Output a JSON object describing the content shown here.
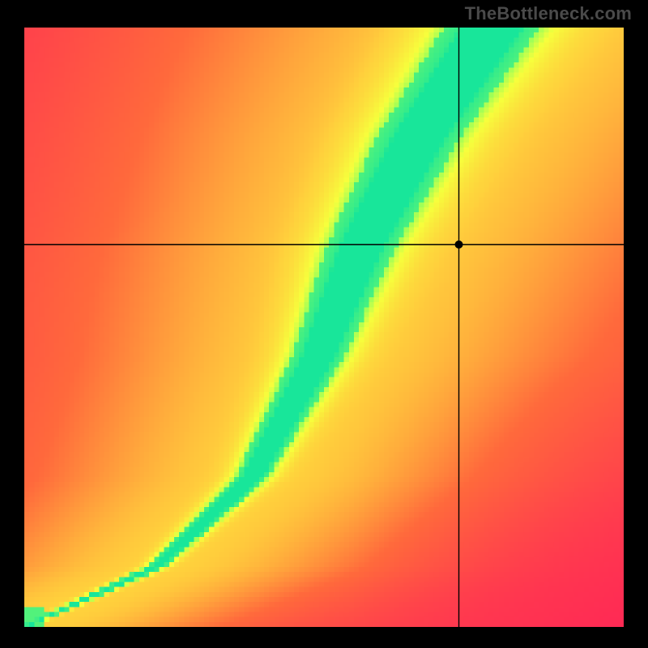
{
  "attribution": "TheBottleneck.com",
  "chart_data": {
    "type": "heatmap",
    "title": "",
    "xlabel": "",
    "ylabel": "",
    "xlim": [
      0,
      1
    ],
    "ylim": [
      0,
      1
    ],
    "grid_resolution": 120,
    "colormap": {
      "stops": [
        {
          "t": 0.0,
          "color": "#ff2a55"
        },
        {
          "t": 0.35,
          "color": "#ff6a3c"
        },
        {
          "t": 0.6,
          "color": "#ffd23c"
        },
        {
          "t": 0.78,
          "color": "#f7ff3c"
        },
        {
          "t": 0.9,
          "color": "#8cff5e"
        },
        {
          "t": 1.0,
          "color": "#18e69a"
        }
      ]
    },
    "ridge": {
      "control_points": [
        {
          "x": 0.0,
          "y": 0.0
        },
        {
          "x": 0.22,
          "y": 0.1
        },
        {
          "x": 0.38,
          "y": 0.25
        },
        {
          "x": 0.49,
          "y": 0.45
        },
        {
          "x": 0.56,
          "y": 0.63
        },
        {
          "x": 0.66,
          "y": 0.82
        },
        {
          "x": 0.78,
          "y": 1.0
        }
      ],
      "width_at_y": [
        {
          "y": 0.0,
          "w": 0.006
        },
        {
          "y": 0.2,
          "w": 0.02
        },
        {
          "y": 0.45,
          "w": 0.038
        },
        {
          "y": 0.7,
          "w": 0.055
        },
        {
          "y": 1.0,
          "w": 0.07
        }
      ]
    },
    "crosshair": {
      "x": 0.725,
      "y": 0.638
    },
    "marker": {
      "x": 0.725,
      "y": 0.638,
      "radius_px": 5
    }
  }
}
